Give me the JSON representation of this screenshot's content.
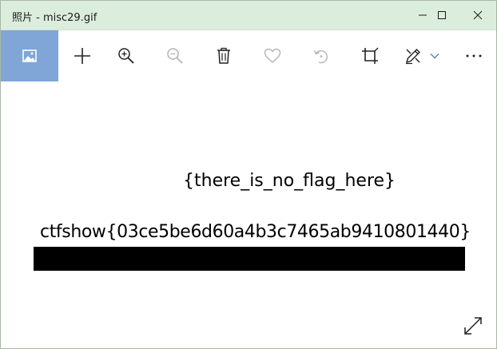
{
  "window": {
    "title": "照片 - misc29.gif",
    "titlebar_color": "#dbeedd",
    "controls": [
      "minimize-icon",
      "maximize-icon",
      "close-icon"
    ]
  },
  "toolbar": {
    "accent": "#7fa6d7",
    "buttons": [
      {
        "icon": "image-icon",
        "state": "active"
      },
      {
        "icon": "add-icon",
        "state": "enabled"
      },
      {
        "icon": "zoom-in-icon",
        "state": "enabled"
      },
      {
        "icon": "zoom-out-icon",
        "state": "disabled"
      },
      {
        "icon": "delete-icon",
        "state": "enabled"
      },
      {
        "icon": "favorite-heart-icon",
        "state": "disabled"
      },
      {
        "icon": "rotate-icon",
        "state": "disabled"
      },
      {
        "icon": "crop-icon",
        "state": "enabled"
      },
      {
        "icon": "edit-draw-icon",
        "state": "enabled"
      },
      {
        "icon": "chevron-down-icon",
        "state": "enabled"
      },
      {
        "icon": "more-icon",
        "state": "enabled"
      }
    ]
  },
  "image": {
    "line1": "{there_is_no_flag_here}",
    "line2": "ctfshow{03ce5be6d60a4b3c7465ab9410801440}",
    "redaction_bar_color": "#000000"
  },
  "footer": {
    "expand_icon": "fullscreen-expand-icon"
  }
}
